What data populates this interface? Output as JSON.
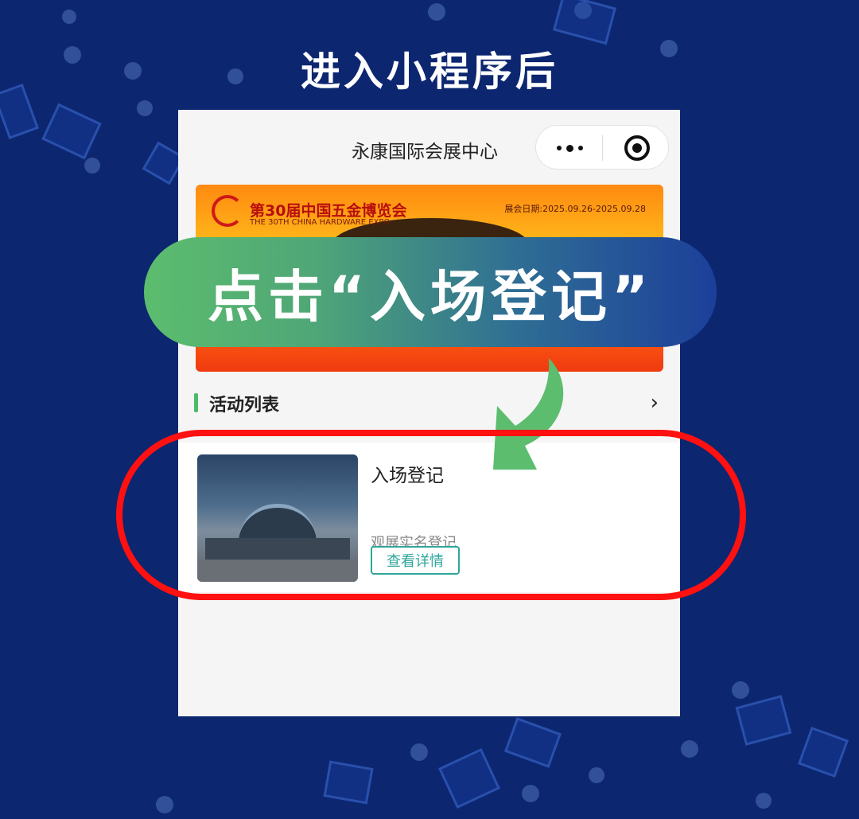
{
  "heading": "进入小程序后",
  "app": {
    "title": "永康国际会展中心",
    "capsule": {
      "more_icon": "more-dots-icon",
      "close_icon": "target-close-icon"
    }
  },
  "banner": {
    "expo_cn": "第30届中国五金博览会",
    "expo_en": "THE 30TH CHINA HARDWARE EXPO",
    "dates": "展会日期:2025.09.26-2025.09.28"
  },
  "section": {
    "label": "活动列表",
    "chevron_icon": "chevron-right-icon"
  },
  "activity": {
    "name": "入场登记",
    "desc": "观展实名登记",
    "button": "查看详情"
  },
  "callout": "点击“入场登记”",
  "colors": {
    "accent_green": "#4cbb6a",
    "teal": "#2fa69a",
    "highlight_red": "#ff1111",
    "bg_blue": "#0c2670"
  }
}
